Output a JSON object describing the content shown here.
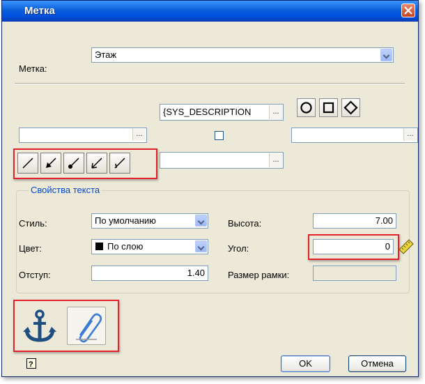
{
  "window": {
    "title": "Метка"
  },
  "label_row": {
    "label": "Метка:",
    "value": "Этаж"
  },
  "description_field": {
    "value": "{SYS_DESCRIPTION",
    "ellipsis": "..."
  },
  "left_field": {
    "value": "",
    "ellipsis": "..."
  },
  "right_field": {
    "value": "",
    "ellipsis": "..."
  },
  "middle_field": {
    "value": "",
    "ellipsis": "..."
  },
  "shape_buttons": [
    "circle-icon",
    "square-icon",
    "diamond-icon"
  ],
  "leader_buttons": [
    "line-icon",
    "arrow-icon",
    "dot-leader-icon",
    "open-arrow-icon",
    "tick-leader-icon"
  ],
  "text_props": {
    "group_title": "Свойства текста",
    "style_label": "Стиль:",
    "style_value": "По умолчанию",
    "color_label": "Цвет:",
    "color_value": "По слою",
    "offset_label": "Отступ:",
    "offset_value": "1.40",
    "height_label": "Высота:",
    "height_value": "7.00",
    "angle_label": "Угол:",
    "angle_value": "0",
    "frame_label": "Размер рамки:",
    "frame_value": ""
  },
  "bottom": {
    "ok": "OK",
    "cancel": "Отмена"
  },
  "colors": {
    "title_bar": "#0a5fd8",
    "highlight": "#e4202a",
    "group_title": "#0046d5",
    "anchor": "#1f4f80"
  }
}
